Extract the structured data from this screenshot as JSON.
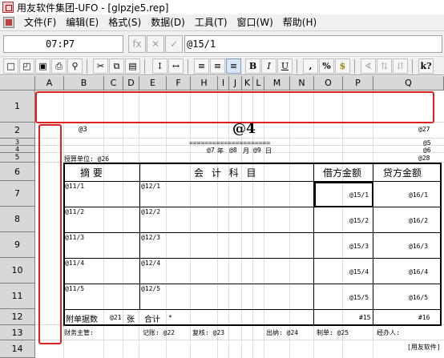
{
  "window": {
    "title": "用友软件集团-UFO - [glpzje5.rep]"
  },
  "menu": [
    "文件(F)",
    "编辑(E)",
    "格式(S)",
    "数据(D)",
    "工具(T)",
    "窗口(W)",
    "帮助(H)"
  ],
  "formula_bar": {
    "cell_ref": "07:P7",
    "fx_label": "fx",
    "cancel_label": "✕",
    "confirm_label": "✓",
    "formula": "@15/1"
  },
  "toolbar": {
    "bold": "B",
    "italic": "I",
    "underline": "U",
    "comma": ",",
    "percent": "%",
    "currency": "$",
    "help": "k?"
  },
  "columns": [
    "A",
    "B",
    "C",
    "D",
    "E",
    "F",
    "H",
    "I",
    "J",
    "K",
    "L",
    "M",
    "N",
    "O",
    "P",
    "Q"
  ],
  "rows": [
    "1",
    "2",
    "3",
    "4",
    "5",
    "6",
    "7",
    "8",
    "9",
    "10",
    "11",
    "12",
    "13",
    "14"
  ],
  "sheet": {
    "r2_left": "@3",
    "r2_title": "@4",
    "r2_right": "@27",
    "r3_equals": "=====================",
    "r3_right": "@5",
    "r4_date_parts": [
      "@7",
      "年",
      "@8",
      "月",
      "@9",
      "日"
    ],
    "r4_right": "@6",
    "r5_unit": "授算单位: @26",
    "r5_right": "@28",
    "header_summary": "摘    要",
    "header_account": "会 计 科 目",
    "header_debit": "借方金额",
    "header_credit": "贷方金额",
    "entries": [
      {
        "summary": "@11/1",
        "account": "@12/1",
        "debit": "@15/1",
        "credit": "@16/1"
      },
      {
        "summary": "@11/2",
        "account": "@12/2",
        "debit": "@15/2",
        "credit": "@16/2"
      },
      {
        "summary": "@11/3",
        "account": "@12/3",
        "debit": "@15/3",
        "credit": "@16/3"
      },
      {
        "summary": "@11/4",
        "account": "@12/4",
        "debit": "@15/4",
        "credit": "@16/4"
      },
      {
        "summary": "@11/5",
        "account": "@12/5",
        "debit": "@15/5",
        "credit": "@16/5"
      }
    ],
    "r12_attach": "附单据数",
    "r12_attach_val": "@21",
    "r12_unit": "张",
    "r12_total": "合计",
    "r12_star": "*",
    "r12_debit": "#15",
    "r12_credit": "#16",
    "r13_items": [
      "财务主管:",
      "记账: @22",
      "复核: @23",
      "出纳: @24",
      "制单: @25",
      "经办人:"
    ],
    "r14_brand": "[用友软件]"
  },
  "colors": {
    "highlight": "#e02020",
    "header_bg": "#d8d8d8"
  }
}
